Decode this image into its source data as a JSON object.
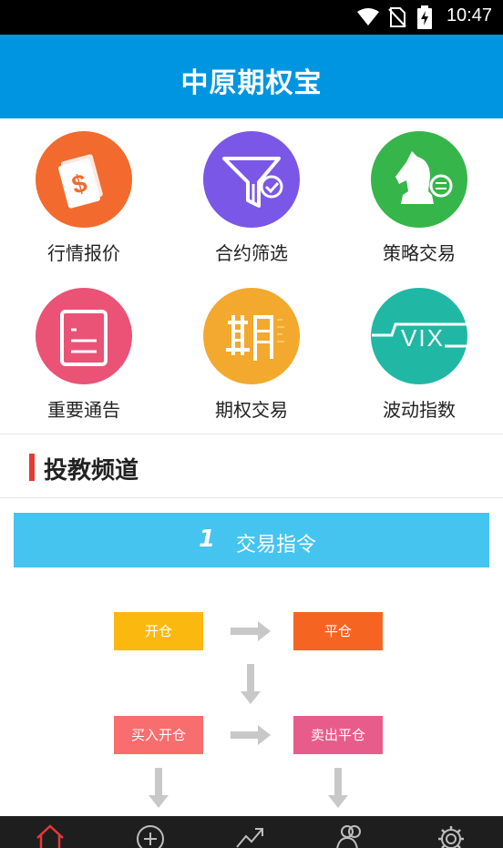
{
  "status_bar": {
    "time": "10:47"
  },
  "app": {
    "title": "中原期权宝"
  },
  "menu": [
    {
      "label": "行情报价",
      "icon": "dollar-card-icon",
      "color": "#f26a2e"
    },
    {
      "label": "合约筛选",
      "icon": "filter-check-icon",
      "color": "#7a57e6"
    },
    {
      "label": "策略交易",
      "icon": "chess-knight-icon",
      "color": "#36b54a"
    },
    {
      "label": "重要通告",
      "icon": "notice-document-icon",
      "color": "#ea5276"
    },
    {
      "label": "期权交易",
      "icon": "qi-character-icon",
      "color": "#f2a92e"
    },
    {
      "label": "波动指数",
      "icon": "vix-icon",
      "color": "#20b8a4"
    }
  ],
  "section": {
    "title": "投教频道"
  },
  "banner": {
    "number": "1",
    "text": "交易指令"
  },
  "flow": {
    "open": "开仓",
    "close": "平仓",
    "buy_open": "买入开仓",
    "sell_close": "卖出平仓",
    "colors": {
      "open": "#fbb80f",
      "close": "#f56521",
      "buy_open": "#f86d6d",
      "sell_close": "#e85c8b",
      "arrow": "#c8c8c8"
    }
  },
  "bottom_nav": [
    {
      "icon": "home-icon",
      "active": true
    },
    {
      "icon": "add-circle-icon",
      "active": false
    },
    {
      "icon": "trend-icon",
      "active": false
    },
    {
      "icon": "users-icon",
      "active": false
    },
    {
      "icon": "settings-icon",
      "active": false
    }
  ]
}
